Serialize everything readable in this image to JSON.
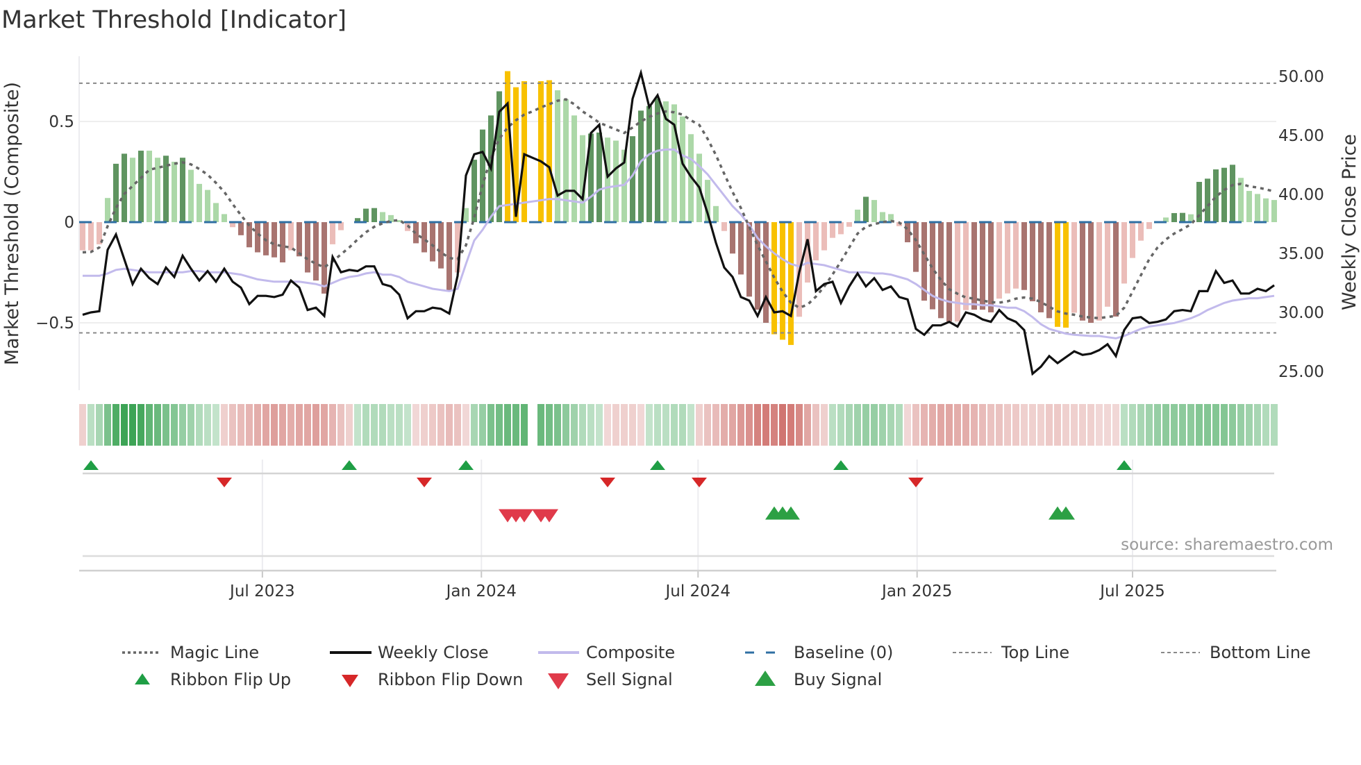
{
  "title": "Market Threshold [Indicator]",
  "source": "source: sharemaestro.com",
  "colors": {
    "bar_strong_up": "#5f9460",
    "bar_weak_up": "#acd8a8",
    "bar_strong_down": "#a87470",
    "bar_weak_down": "#ebbdb9",
    "bar_extreme": "#f8c100",
    "ribbon_up": "#34a04e",
    "ribbon_down": "#c9605b",
    "magic_line": "#666666",
    "weekly_close": "#111111",
    "composite": "#c2baec",
    "baseline": "#2f6fa3",
    "threshold_lines": "#888888",
    "flip_up": "#1f9e45",
    "flip_down": "#d62728",
    "sell": "#e03a4a",
    "buy": "#2ca044"
  },
  "chart_data": {
    "type": "bar",
    "title": "Market Threshold [Indicator]",
    "ylabel": "Market Threshold (Composite)",
    "ylabel_right": "Weekly Close Price",
    "xlabel": "",
    "start_date": "2023-01-31",
    "frequency": "weekly",
    "ylim": [
      -0.83,
      0.83
    ],
    "ylim_right": [
      22.6,
      54.8
    ],
    "grid": true,
    "legend_position": "bottom",
    "yticks_left": {
      "values": [
        0.5,
        0,
        -0.5
      ],
      "labels": [
        "0.5",
        "0",
        "−0.5"
      ]
    },
    "yticks_right": {
      "values": [
        50,
        45,
        40,
        35,
        30,
        25
      ],
      "labels": [
        "50.00",
        "45.00",
        "40.00",
        "35.00",
        "30.00",
        "25.00"
      ]
    },
    "xticks": {
      "dates": [
        "2023-07-01",
        "2024-01-01",
        "2024-07-01",
        "2025-01-01",
        "2025-07-01"
      ],
      "labels": [
        "Jul 2023",
        "Jan 2024",
        "Jul 2024",
        "Jan 2025",
        "Jul 2025"
      ]
    },
    "top_line": 0.69,
    "bottom_line": -0.55,
    "baseline": 0,
    "composite_bars": [
      -0.14,
      -0.14,
      -0.11,
      0.12,
      0.29,
      0.34,
      0.32,
      0.355,
      0.355,
      0.32,
      0.33,
      0.3,
      0.32,
      0.26,
      0.19,
      0.16,
      0.095,
      0.04,
      -0.025,
      -0.065,
      -0.125,
      -0.15,
      -0.165,
      -0.175,
      -0.2,
      -0.14,
      -0.17,
      -0.25,
      -0.29,
      -0.355,
      -0.11,
      -0.04,
      0,
      0.02,
      0.067,
      0.07,
      0.05,
      0.035,
      0.01,
      -0.044,
      -0.105,
      -0.15,
      -0.195,
      -0.23,
      -0.34,
      -0.25,
      0.07,
      0.31,
      0.46,
      0.53,
      0.65,
      0.75,
      0.67,
      0.7,
      null,
      0.7,
      0.705,
      0.655,
      0.61,
      0.53,
      0.432,
      0.44,
      0.445,
      0.42,
      0.405,
      0.36,
      0.427,
      0.554,
      0.577,
      0.615,
      0.6,
      0.585,
      0.525,
      0.437,
      0.34,
      0.21,
      0.08,
      -0.044,
      -0.156,
      -0.26,
      -0.37,
      -0.435,
      -0.5,
      -0.557,
      -0.584,
      -0.61,
      -0.47,
      -0.3,
      -0.19,
      -0.14,
      -0.078,
      -0.06,
      -0.023,
      0.062,
      0.126,
      0.11,
      0.05,
      0.04,
      -0.02,
      -0.1,
      -0.247,
      -0.39,
      -0.433,
      -0.477,
      -0.494,
      -0.494,
      -0.437,
      -0.435,
      -0.435,
      -0.448,
      -0.38,
      -0.354,
      -0.33,
      -0.337,
      -0.393,
      -0.448,
      -0.477,
      -0.52,
      -0.524,
      -0.45,
      -0.489,
      -0.5,
      -0.489,
      -0.42,
      -0.469,
      -0.305,
      -0.178,
      -0.092,
      -0.034,
      0,
      0.023,
      0.045,
      0.046,
      0.039,
      0.2,
      0.216,
      0.262,
      0.27,
      0.285,
      0.22,
      0.155,
      0.14,
      0.118,
      0.11
    ],
    "bar_states": "rrrgGGgGggGgGgggggrRRRRRRrRRRRrrrGGGgggrRRRRRrgGGGGYYY-YYggggGGgggGGGGgggggggrRRRRRYYYrrrrrrrgGgggrRRRRRRrrRRRrrrRRRRYYrRRrrRrrrrrgGGgGGGGGggggg",
    "weekly_close": [
      29.8,
      30.0,
      30.1,
      35.3,
      36.6,
      34.5,
      32.4,
      33.7,
      32.9,
      32.4,
      33.8,
      33.0,
      34.8,
      33.7,
      32.7,
      33.5,
      32.6,
      33.7,
      32.6,
      32.1,
      30.7,
      31.4,
      31.4,
      31.3,
      31.5,
      32.7,
      32.1,
      30.2,
      30.4,
      29.7,
      34.7,
      33.4,
      33.6,
      33.5,
      33.9,
      33.9,
      32.4,
      32.2,
      31.5,
      29.5,
      30.1,
      30.1,
      30.4,
      30.3,
      29.9,
      33.1,
      41.6,
      43.4,
      43.6,
      42.2,
      47.0,
      47.7,
      38.1,
      43.4,
      43.1,
      42.8,
      42.3,
      39.9,
      40.3,
      40.3,
      39.6,
      45.2,
      45.9,
      41.5,
      42.2,
      42.7,
      48.1,
      50.3,
      47.4,
      48.4,
      46.4,
      45.9,
      42.6,
      41.5,
      40.6,
      38.4,
      35.9,
      33.8,
      33.0,
      31.3,
      31.0,
      29.7,
      31.3,
      30.0,
      30.1,
      29.7,
      33.4,
      36.2,
      31.8,
      32.4,
      32.6,
      30.8,
      32.2,
      33.3,
      32.2,
      32.9,
      31.9,
      32.2,
      31.3,
      31.1,
      28.6,
      28.1,
      28.9,
      28.9,
      29.2,
      28.8,
      30.0,
      29.8,
      29.4,
      29.2,
      30.2,
      29.5,
      29.2,
      28.5,
      24.8,
      25.4,
      26.3,
      25.7,
      26.2,
      26.7,
      26.4,
      26.5,
      26.8,
      27.3,
      26.3,
      28.5,
      29.5,
      29.6,
      29.1,
      29.2,
      29.4,
      30.1,
      30.2,
      30.1,
      31.8,
      31.8,
      33.5,
      32.5,
      32.7,
      31.6,
      31.6,
      32.0,
      31.8,
      32.3
    ],
    "composite_line": [
      33.1,
      33.1,
      33.1,
      33.3,
      33.6,
      33.7,
      33.6,
      33.5,
      33.4,
      33.4,
      33.4,
      33.4,
      33.4,
      33.5,
      33.5,
      33.4,
      33.4,
      33.4,
      33.3,
      33.2,
      33.0,
      32.8,
      32.7,
      32.6,
      32.6,
      32.6,
      32.6,
      32.5,
      32.4,
      32.2,
      32.5,
      32.8,
      33.0,
      33.1,
      33.3,
      33.4,
      33.2,
      33.2,
      33.0,
      32.6,
      32.4,
      32.2,
      32.0,
      31.9,
      31.8,
      32.0,
      34.1,
      36.1,
      37.0,
      38.1,
      39.0,
      39.1,
      39.2,
      39.3,
      39.4,
      39.5,
      39.6,
      39.6,
      39.5,
      39.4,
      39.3,
      39.8,
      40.4,
      40.6,
      40.7,
      40.8,
      41.6,
      42.8,
      43.4,
      43.7,
      43.8,
      43.8,
      43.3,
      43.0,
      42.4,
      41.7,
      40.8,
      39.9,
      39.0,
      38.3,
      37.4,
      36.3,
      35.6,
      35.0,
      34.5,
      34.1,
      33.9,
      34.2,
      34.1,
      34.0,
      33.8,
      33.6,
      33.4,
      33.4,
      33.4,
      33.3,
      33.3,
      33.2,
      33.0,
      32.8,
      32.4,
      31.9,
      31.4,
      31.1,
      30.9,
      30.8,
      30.7,
      30.7,
      30.6,
      30.6,
      30.5,
      30.4,
      30.4,
      30.1,
      29.6,
      29.0,
      28.6,
      28.4,
      28.2,
      28.1,
      28.05,
      28.0,
      28.0,
      27.9,
      27.8,
      28.0,
      28.3,
      28.6,
      28.8,
      28.9,
      29.0,
      29.1,
      29.3,
      29.5,
      29.8,
      30.2,
      30.5,
      30.8,
      31.0,
      31.1,
      31.2,
      31.2,
      31.3,
      31.4
    ],
    "magic_line": [
      -0.15,
      -0.148,
      -0.126,
      -0.02,
      0.07,
      0.14,
      0.18,
      0.22,
      0.26,
      0.27,
      0.28,
      0.29,
      0.297,
      0.287,
      0.264,
      0.236,
      0.195,
      0.15,
      0.09,
      0.035,
      -0.017,
      -0.057,
      -0.09,
      -0.11,
      -0.12,
      -0.126,
      -0.155,
      -0.184,
      -0.207,
      -0.224,
      -0.195,
      -0.16,
      -0.126,
      -0.086,
      -0.05,
      -0.023,
      -0.006,
      0.006,
      0.01,
      -0.017,
      -0.057,
      -0.086,
      -0.115,
      -0.15,
      -0.178,
      -0.184,
      -0.115,
      0.023,
      0.184,
      0.32,
      0.414,
      0.47,
      0.506,
      0.534,
      0.55,
      0.57,
      0.586,
      0.603,
      0.61,
      0.586,
      0.55,
      0.523,
      0.494,
      0.477,
      0.46,
      0.443,
      0.47,
      0.5,
      0.523,
      0.54,
      0.55,
      0.546,
      0.534,
      0.506,
      0.483,
      0.414,
      0.333,
      0.24,
      0.15,
      0.07,
      -0.023,
      -0.115,
      -0.195,
      -0.276,
      -0.345,
      -0.4,
      -0.425,
      -0.41,
      -0.37,
      -0.32,
      -0.26,
      -0.195,
      -0.126,
      -0.057,
      -0.023,
      -0.01,
      0,
      0.006,
      -0.002,
      -0.035,
      -0.09,
      -0.16,
      -0.23,
      -0.287,
      -0.333,
      -0.356,
      -0.374,
      -0.38,
      -0.39,
      -0.397,
      -0.4,
      -0.393,
      -0.38,
      -0.374,
      -0.38,
      -0.397,
      -0.42,
      -0.443,
      -0.454,
      -0.46,
      -0.469,
      -0.474,
      -0.477,
      -0.471,
      -0.466,
      -0.425,
      -0.345,
      -0.264,
      -0.184,
      -0.126,
      -0.086,
      -0.057,
      -0.035,
      -0.011,
      0.034,
      0.08,
      0.126,
      0.16,
      0.184,
      0.19,
      0.178,
      0.172,
      0.163,
      0.152
    ],
    "ribbon": [
      -0.2,
      0.25,
      0.35,
      0.6,
      0.85,
      0.95,
      0.95,
      0.9,
      0.75,
      0.7,
      0.6,
      0.55,
      0.45,
      0.4,
      0.3,
      0.25,
      0.2,
      -0.2,
      -0.3,
      -0.35,
      -0.4,
      -0.45,
      -0.5,
      -0.55,
      -0.5,
      -0.45,
      -0.5,
      -0.5,
      -0.55,
      -0.5,
      -0.4,
      -0.3,
      -0.2,
      0.2,
      0.3,
      0.3,
      0.3,
      0.25,
      0.25,
      0.2,
      -0.15,
      -0.2,
      -0.25,
      -0.3,
      -0.35,
      -0.3,
      -0.15,
      0.35,
      0.45,
      0.6,
      0.65,
      0.7,
      0.7,
      0.75,
      null,
      0.7,
      0.65,
      0.6,
      0.5,
      0.4,
      0.3,
      0.25,
      0.2,
      -0.15,
      -0.2,
      -0.2,
      -0.2,
      -0.15,
      0.2,
      0.25,
      0.25,
      0.3,
      0.3,
      0.2,
      -0.2,
      -0.3,
      -0.35,
      -0.45,
      -0.5,
      -0.6,
      -0.65,
      -0.75,
      -0.8,
      -0.75,
      -0.85,
      -0.8,
      -0.7,
      -0.5,
      -0.3,
      -0.2,
      0.25,
      0.3,
      0.35,
      0.4,
      0.45,
      0.45,
      0.4,
      0.35,
      0.3,
      -0.15,
      -0.3,
      -0.4,
      -0.45,
      -0.5,
      -0.5,
      -0.45,
      -0.45,
      -0.4,
      -0.35,
      -0.3,
      -0.3,
      -0.25,
      -0.25,
      -0.2,
      -0.2,
      -0.2,
      -0.25,
      -0.25,
      -0.2,
      -0.2,
      -0.2,
      -0.2,
      -0.15,
      -0.15,
      -0.15,
      0.25,
      0.3,
      0.35,
      0.4,
      0.45,
      0.5,
      0.5,
      0.5,
      0.5,
      0.55,
      0.55,
      0.55,
      0.55,
      0.5,
      0.45,
      0.4,
      0.35,
      0.3,
      0.3
    ],
    "ribbon_flip_up_weeks": [
      2,
      33,
      47,
      70,
      92,
      126
    ],
    "ribbon_flip_down_weeks": [
      18,
      42,
      64,
      75,
      101
    ],
    "sell_signal_weeks": [
      52,
      53,
      54,
      56,
      57
    ],
    "buy_signal_weeks": [
      84,
      85,
      86,
      118,
      119
    ]
  },
  "legend": [
    {
      "label": "Magic Line",
      "icon": "dotted-line-icon"
    },
    {
      "label": "Weekly Close",
      "icon": "solid-line-icon"
    },
    {
      "label": "Composite",
      "icon": "lavender-line-icon"
    },
    {
      "label": "Baseline (0)",
      "icon": "dashed-line-icon"
    },
    {
      "label": "Top Line",
      "icon": "dashed-line-icon"
    },
    {
      "label": "Bottom Line",
      "icon": "dashed-line-icon"
    },
    {
      "label": "Ribbon Flip Up",
      "icon": "triangle-up-icon"
    },
    {
      "label": "Ribbon Flip Down",
      "icon": "triangle-down-icon"
    },
    {
      "label": "Sell Signal",
      "icon": "triangle-down-icon"
    },
    {
      "label": "Buy Signal",
      "icon": "triangle-up-icon"
    }
  ]
}
